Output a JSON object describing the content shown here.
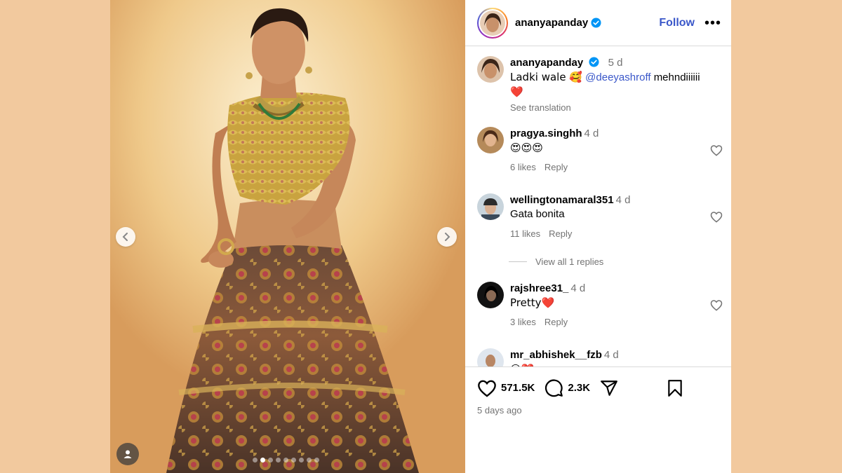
{
  "post": {
    "author": "ananyapanday",
    "follow_label": "Follow",
    "more_label": "•••",
    "caption_time": "5 d",
    "caption_text": "Ladki wale 🥰",
    "caption_mention": "@deeyashroff",
    "caption_tail": "mehndiiiiii",
    "caption_emoji": "❤️",
    "see_translation": "See translation",
    "carousel": {
      "count": 9,
      "active_index": 1
    }
  },
  "comments": [
    {
      "user": "pragya.singhh",
      "time": "4 d",
      "text": "😍😍😍",
      "likes": "6 likes",
      "reply": "Reply"
    },
    {
      "user": "wellingtonamaral351",
      "time": "4 d",
      "text": "Gata bonita",
      "likes": "11 likes",
      "reply": "Reply",
      "view_replies": "View all 1 replies"
    },
    {
      "user": "rajshree31_",
      "time": "4 d",
      "text": "Pretty❤️",
      "likes": "3 likes",
      "reply": "Reply"
    },
    {
      "user": "mr_abhishek__fzb",
      "time": "4 d",
      "text": "😍❤️",
      "likes": "",
      "reply": ""
    }
  ],
  "actions": {
    "likes_count": "571.5K",
    "comments_count": "2.3K",
    "posted_ago": "5 days ago"
  },
  "icons": {
    "like": "heart-icon",
    "comment": "comment-bubble-icon",
    "share": "paper-plane-icon",
    "save": "bookmark-icon",
    "prev": "chevron-left-icon",
    "next": "chevron-right-icon",
    "tags": "user-tag-icon",
    "verified": "verified-badge-icon"
  },
  "colors": {
    "accent": "#3a57c9",
    "verified": "#0095f6",
    "heart": "#e0245e",
    "page_bg": "#f2c99e"
  }
}
